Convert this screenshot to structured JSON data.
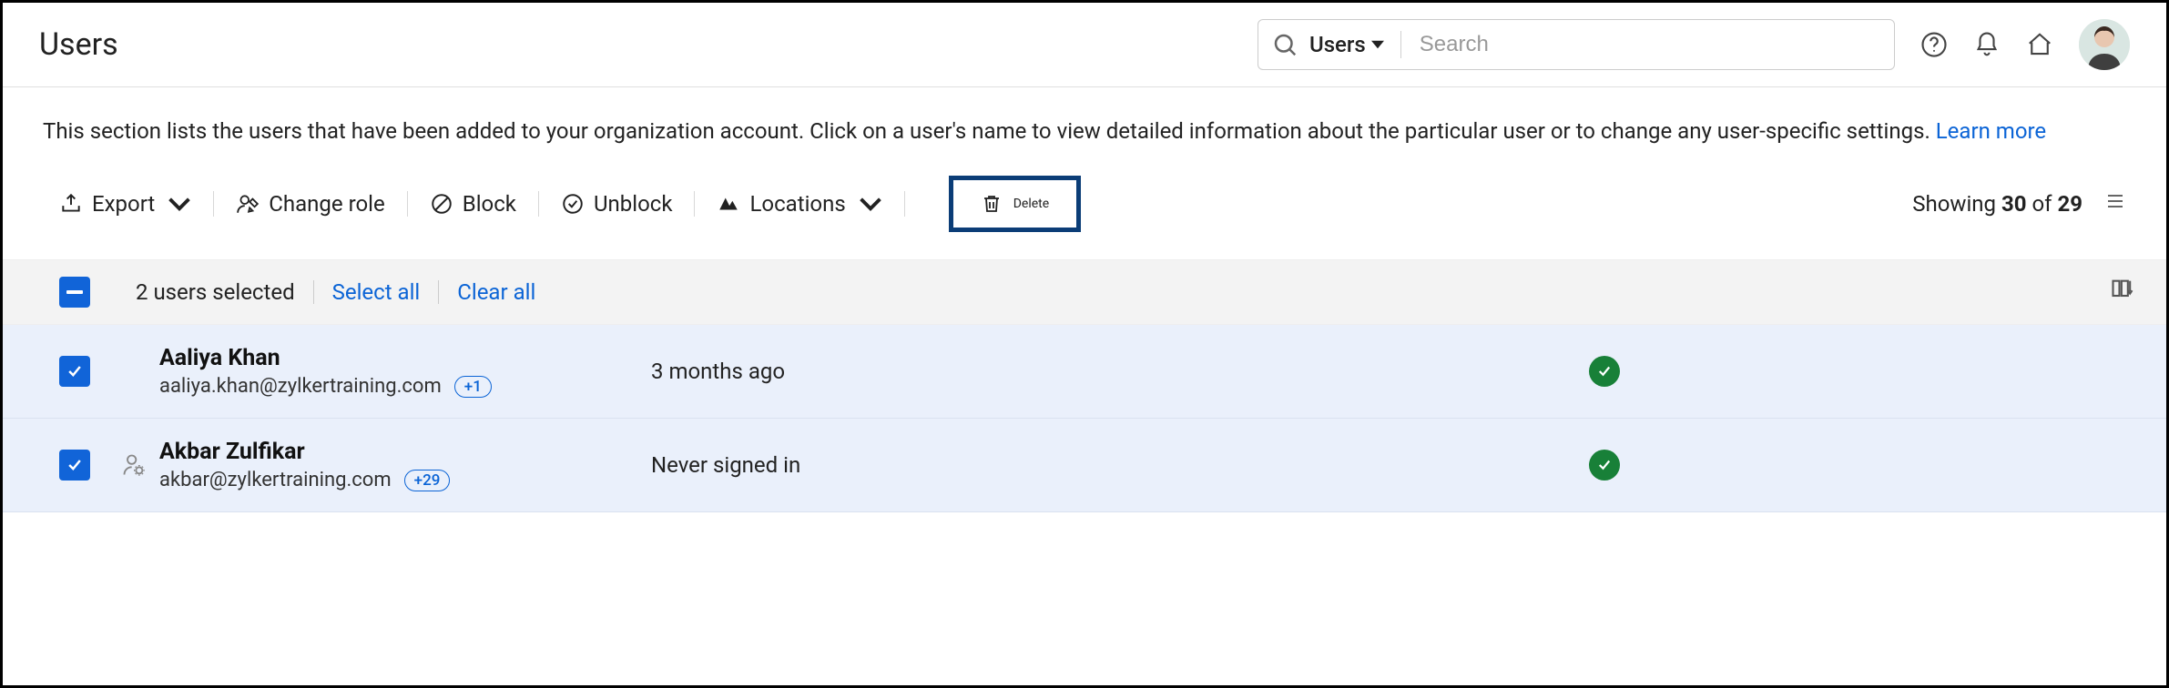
{
  "header": {
    "title": "Users",
    "search": {
      "scope_label": "Users",
      "placeholder": "Search"
    }
  },
  "description": {
    "text": "This section lists the users that have been added to your organization account. Click on a user's name to view detailed information about the particular user or to change any user-specific settings. ",
    "learn_more": "Learn more"
  },
  "toolbar": {
    "export": "Export",
    "change_role": "Change role",
    "block": "Block",
    "unblock": "Unblock",
    "locations": "Locations",
    "delete": "Delete",
    "showing_prefix": "Showing ",
    "showing_count": "30",
    "showing_of": " of ",
    "showing_total": "29"
  },
  "selection": {
    "selected_text": "2 users selected",
    "select_all": "Select all",
    "clear_all": "Clear all"
  },
  "rows": [
    {
      "name": "Aaliya Khan",
      "email": "aaliya.khan@zylkertraining.com",
      "extra_count": "+1",
      "last_seen": "3 months ago",
      "has_user_icon": false
    },
    {
      "name": "Akbar Zulfikar",
      "email": "akbar@zylkertraining.com",
      "extra_count": "+29",
      "last_seen": "Never signed in",
      "has_user_icon": true
    }
  ]
}
